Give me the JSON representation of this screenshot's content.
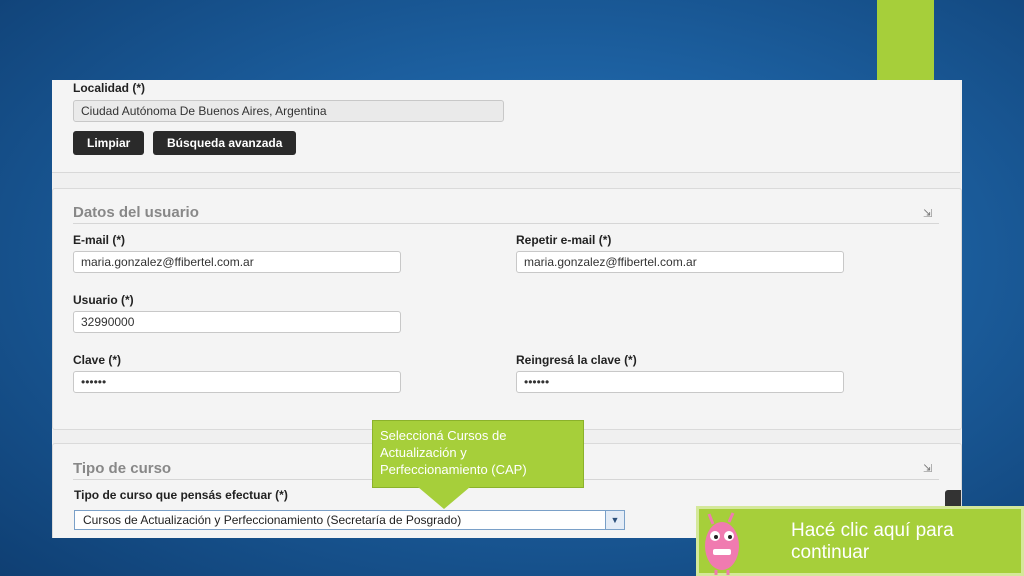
{
  "location": {
    "label": "Localidad (*)",
    "value": "Ciudad Autónoma De Buenos Aires, Argentina",
    "clear_button": "Limpiar",
    "advanced_search_button": "Búsqueda avanzada"
  },
  "user_section": {
    "title": "Datos del usuario",
    "email_label": "E-mail (*)",
    "email_value": "maria.gonzalez@ffibertel.com.ar",
    "repeat_email_label": "Repetir e-mail (*)",
    "repeat_email_value": "maria.gonzalez@ffibertel.com.ar",
    "username_label": "Usuario (*)",
    "username_value": "32990000",
    "password_label": "Clave (*)",
    "password_value": "••••••",
    "repeat_password_label": "Reingresá la clave (*)",
    "repeat_password_value": "••••••"
  },
  "course_section": {
    "title": "Tipo de curso",
    "course_type_label": "Tipo de curso que pensás efectuar (*)",
    "course_type_selected": "Cursos de Actualización y Perfeccionamiento (Secretaría de Posgrado)"
  },
  "tooltip": {
    "text": "Seleccioná Cursos de Actualización y Perfeccionamiento (CAP)"
  },
  "cta": {
    "text": "Hacé clic aquí para continuar"
  },
  "colors": {
    "accent_green": "#a6cf3a",
    "background_blue": "#1c5f9f",
    "button_dark": "#2a2a2a"
  }
}
